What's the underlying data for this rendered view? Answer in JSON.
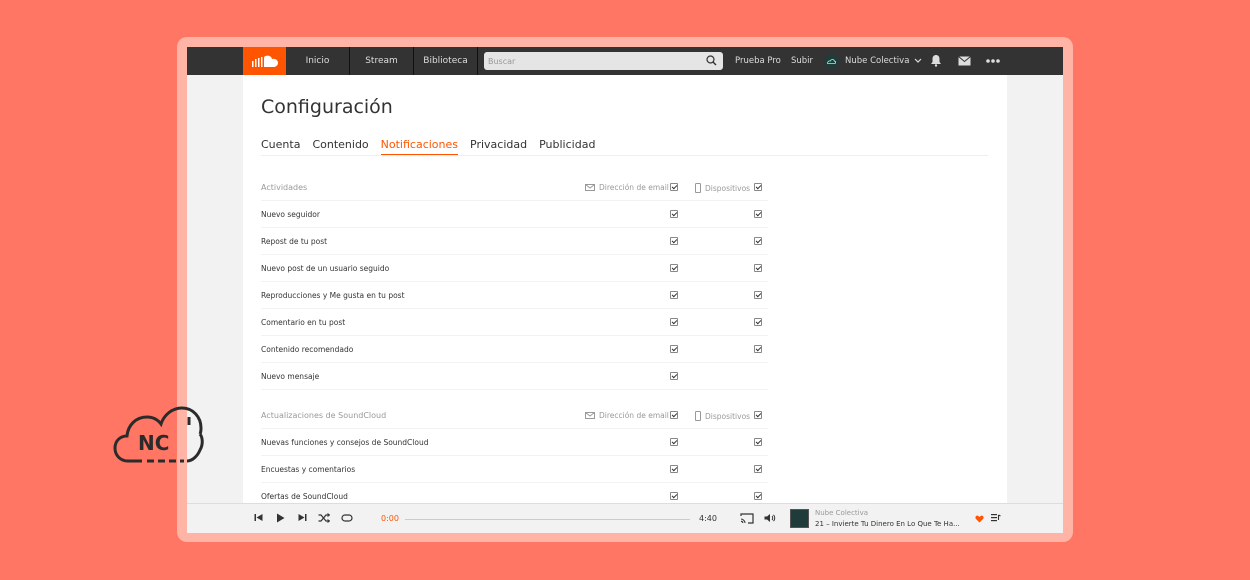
{
  "nav": {
    "tabs": [
      "Inicio",
      "Stream",
      "Biblioteca"
    ],
    "search_placeholder": "Buscar",
    "links": {
      "pro": "Prueba Pro",
      "upload": "Subir"
    },
    "user": "Nube Colectiva"
  },
  "page": {
    "title": "Configuración",
    "tabs": [
      "Cuenta",
      "Contenido",
      "Notificaciones",
      "Privacidad",
      "Publicidad"
    ],
    "active_tab": "Notificaciones"
  },
  "sections": [
    {
      "header": "Actividades",
      "email_label": "Dirección de email",
      "device_label": "Dispositivos",
      "items": [
        {
          "label": "Nuevo seguidor",
          "email": true,
          "device": true
        },
        {
          "label": "Repost de tu post",
          "email": true,
          "device": true
        },
        {
          "label": "Nuevo post de un usuario seguido",
          "email": true,
          "device": true
        },
        {
          "label": "Reproducciones y Me gusta en tu post",
          "email": true,
          "device": true
        },
        {
          "label": "Comentario en tu post",
          "email": true,
          "device": true
        },
        {
          "label": "Contenido recomendado",
          "email": true,
          "device": true
        },
        {
          "label": "Nuevo mensaje",
          "email": true,
          "device": null
        }
      ]
    },
    {
      "header": "Actualizaciones de SoundCloud",
      "email_label": "Dirección de email",
      "device_label": "Dispositivos",
      "items": [
        {
          "label": "Nuevas funciones y consejos de SoundCloud",
          "email": true,
          "device": true
        },
        {
          "label": "Encuestas y comentarios",
          "email": true,
          "device": true
        },
        {
          "label": "Ofertas de SoundCloud",
          "email": true,
          "device": true
        }
      ]
    }
  ],
  "player": {
    "current_time": "0:00",
    "duration": "4:40",
    "artist": "Nube Colectiva",
    "track": "21 – Invierte Tu Dinero En Lo Que Te Ha..."
  },
  "brand_logo_text": "NC",
  "colors": {
    "accent": "#ff5500",
    "background": "#ff7664",
    "frame": "#ffb4a6",
    "topbar": "#333333"
  }
}
